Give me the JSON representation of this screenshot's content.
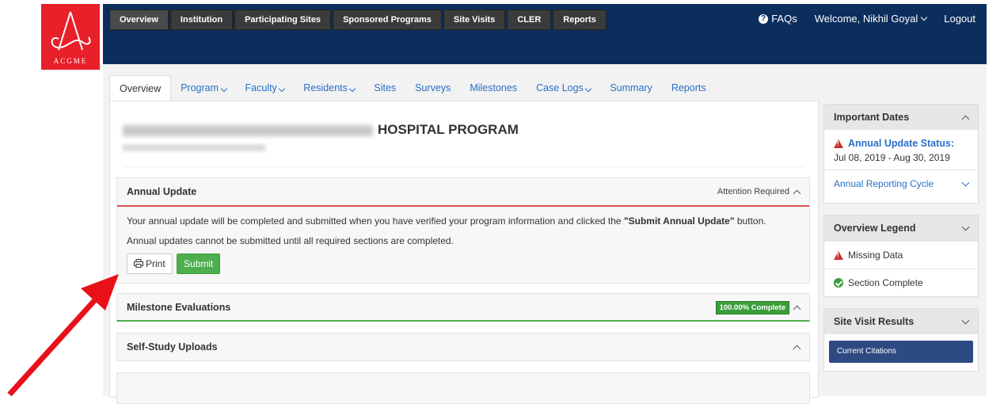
{
  "brand": {
    "logo_text": "ACGME"
  },
  "topnav": {
    "items": [
      "Overview",
      "Institution",
      "Participating Sites",
      "Sponsored Programs",
      "Site Visits",
      "CLER",
      "Reports"
    ]
  },
  "topright": {
    "faqs": "FAQs",
    "welcome": "Welcome, Nikhil Goyal",
    "logout": "Logout"
  },
  "subnav": {
    "tabs": [
      "Overview",
      "Program",
      "Faculty",
      "Residents",
      "Sites",
      "Surveys",
      "Milestones",
      "Case Logs",
      "Summary",
      "Reports"
    ],
    "dropdown_tabs": [
      "Program",
      "Faculty",
      "Residents",
      "Case Logs"
    ]
  },
  "program": {
    "title_suffix": "HOSPITAL PROGRAM"
  },
  "annual_update": {
    "title": "Annual Update",
    "status": "Attention Required",
    "text1_prefix": "Your annual update will be completed and submitted when you have verified your program information and clicked the ",
    "text1_strong": "\"Submit Annual Update\"",
    "text1_suffix": " button.",
    "text2": "Annual updates cannot be submitted until all required sections are completed.",
    "print_label": "Print",
    "submit_label": "Submit"
  },
  "milestone": {
    "title": "Milestone Evaluations",
    "badge": "100.00% Complete"
  },
  "selfstudy": {
    "title": "Self-Study Uploads"
  },
  "important_dates": {
    "title": "Important Dates",
    "status_label": "Annual Update Status:",
    "dates": "Jul 08, 2019 - Aug 30, 2019",
    "cycle_label": "Annual Reporting Cycle"
  },
  "legend": {
    "title": "Overview Legend",
    "missing": "Missing Data",
    "complete": "Section Complete"
  },
  "site_visit": {
    "title": "Site Visit Results",
    "button": "Current Citations"
  },
  "colors": {
    "header": "#0b2e5d",
    "logo": "#e8202a",
    "link": "#2a6fc9",
    "success": "#4cae4c",
    "warning": "#c9302c",
    "arrow": "#e8111a"
  }
}
